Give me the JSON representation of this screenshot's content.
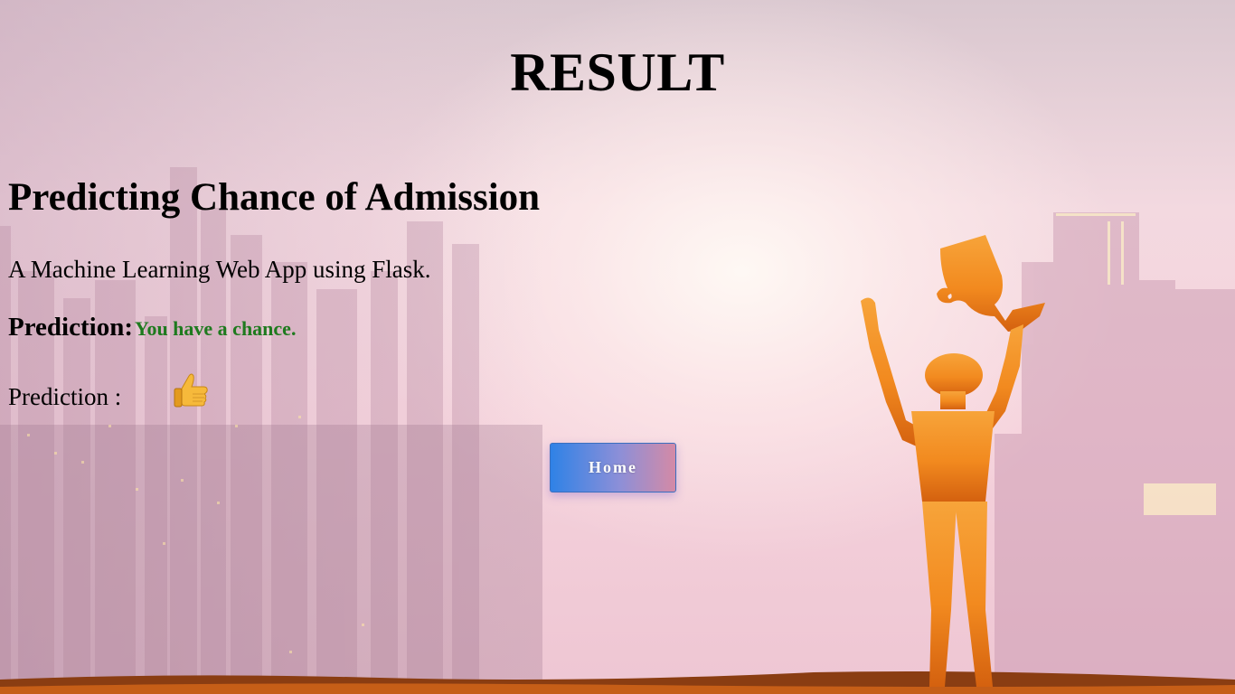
{
  "page": {
    "title": "RESULT",
    "heading": "Predicting Chance of Admission",
    "subtitle": "A Machine Learning Web App using Flask."
  },
  "prediction": {
    "label": "Prediction:",
    "result": "You have a chance.",
    "result_color": "#1e7a1e",
    "icon_label": "Prediction :",
    "icon": "thumbs-up-icon"
  },
  "actions": {
    "home_label": "Home"
  },
  "background": {
    "description_icon": "trophy-winner-silhouette-icon",
    "accent": "#f08a1c"
  }
}
